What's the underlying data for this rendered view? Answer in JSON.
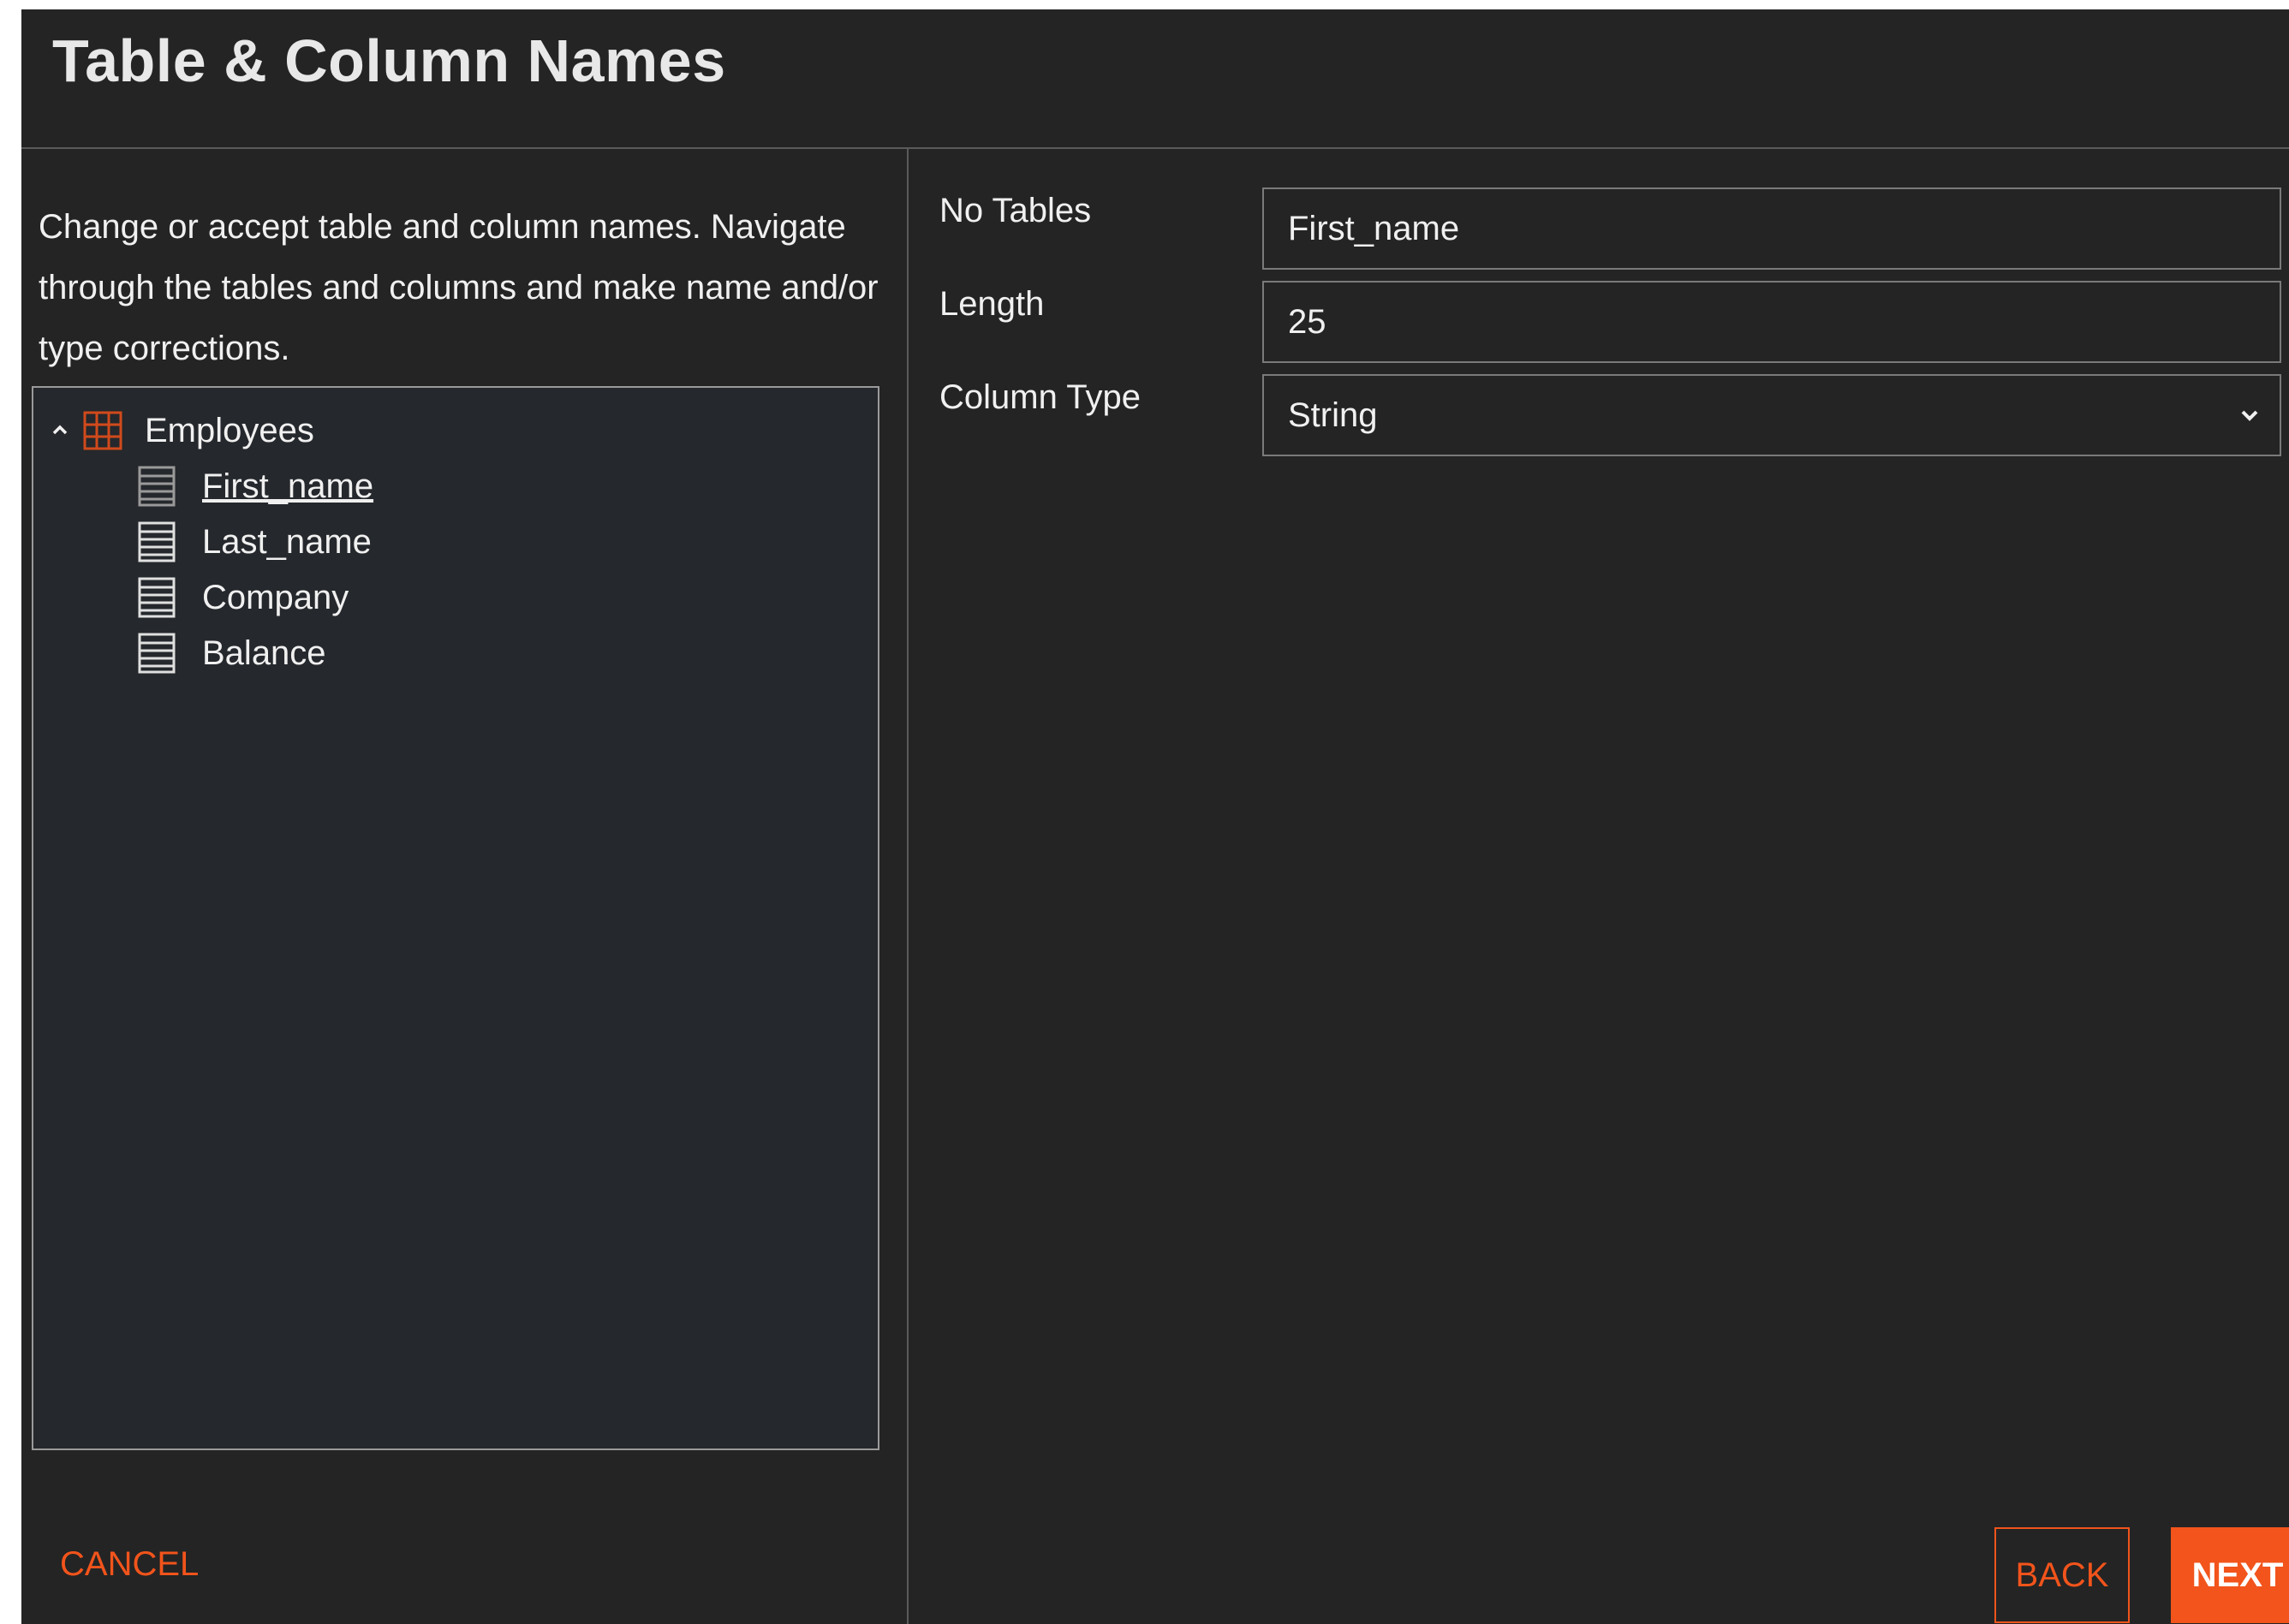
{
  "dialog": {
    "title": "Table & Column Names"
  },
  "left_pane": {
    "description": "Change or accept table and column names. Navigate through the tables and columns and make name and/or type corrections.",
    "tree": {
      "table": {
        "label": "Employees",
        "icon": "table-grid-icon",
        "expanded": true
      },
      "columns": [
        {
          "label": "First_name",
          "icon": "column-icon",
          "selected": true
        },
        {
          "label": "Last_name",
          "icon": "column-icon",
          "selected": false
        },
        {
          "label": "Company",
          "icon": "column-icon",
          "selected": false
        },
        {
          "label": "Balance",
          "icon": "column-icon",
          "selected": false
        }
      ]
    }
  },
  "right_pane": {
    "name_field": {
      "label": "No Tables",
      "value": "First_name"
    },
    "length_field": {
      "label": "Length",
      "value": "25"
    },
    "type_field": {
      "label": "Column Type",
      "value": "String"
    }
  },
  "footer": {
    "cancel_label": "CANCEL",
    "back_label": "BACK",
    "next_label": "NEXT"
  },
  "colors": {
    "accent": "#f2541b",
    "background": "#242424",
    "tree_background": "#25282c"
  }
}
